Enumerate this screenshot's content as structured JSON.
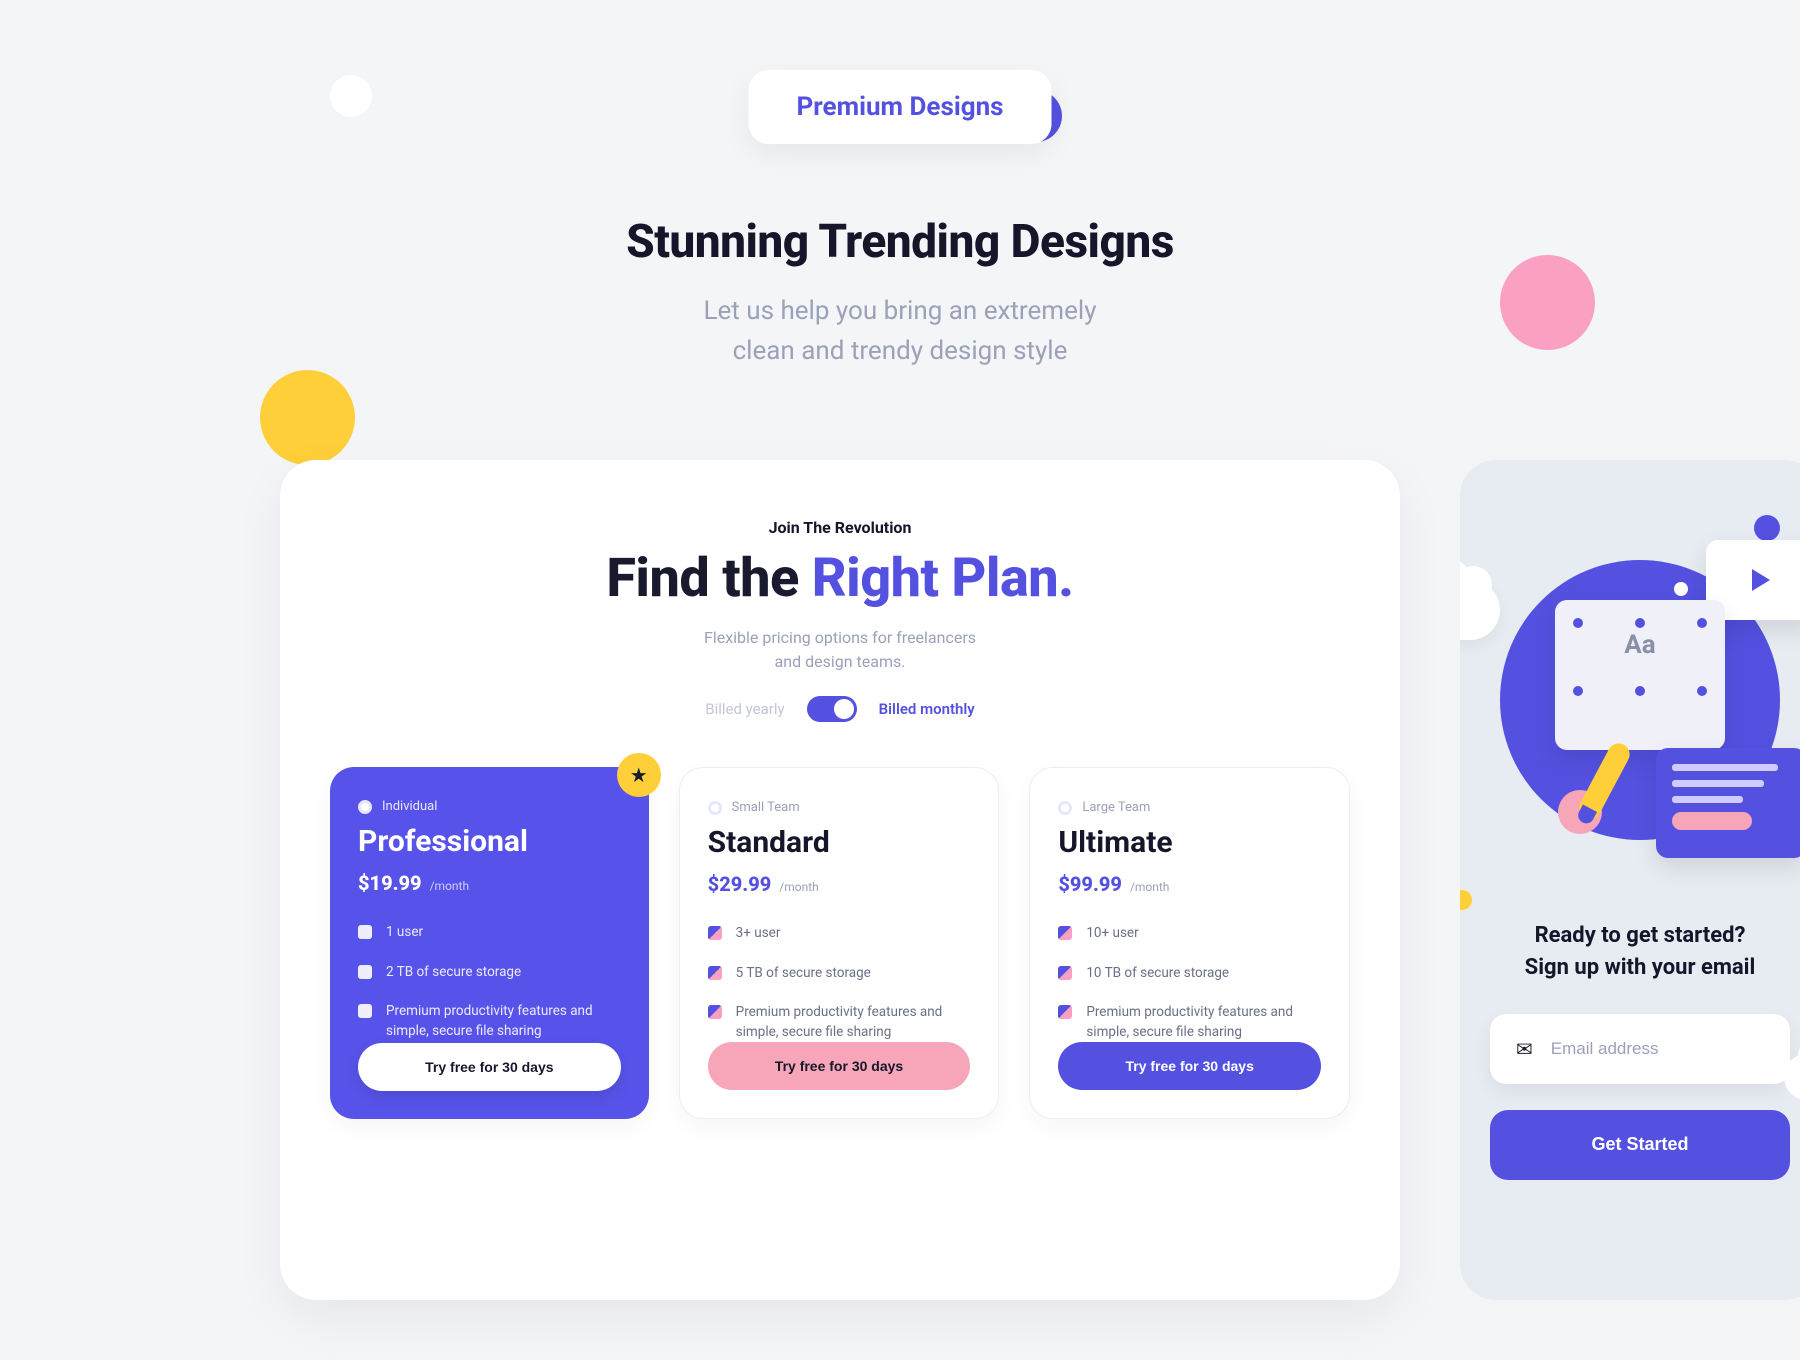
{
  "badge": "Premium Designs",
  "hero": {
    "title": "Stunning Trending Designs",
    "subtitle_l1": "Let us help you bring an extremely",
    "subtitle_l2": "clean and trendy design style"
  },
  "pricing": {
    "eyebrow": "Join The Revolution",
    "title_part1": "Find the ",
    "title_accent": "Right Plan.",
    "subtitle_l1": "Flexible pricing options for freelancers",
    "subtitle_l2": "and design teams.",
    "billing_yearly": "Billed yearly",
    "billing_monthly": "Billed monthly",
    "billing_selected": "monthly",
    "plans": [
      {
        "tag": "Individual",
        "name": "Professional",
        "price": "$19.99",
        "period": "/month",
        "featured": true,
        "cta": "Try free for 30 days",
        "features": [
          "1 user",
          "2 TB of secure storage",
          "Premium productivity features and simple, secure file sharing"
        ]
      },
      {
        "tag": "Small Team",
        "name": "Standard",
        "price": "$29.99",
        "period": "/month",
        "featured": false,
        "cta": "Try free for 30 days",
        "features": [
          "3+ user",
          "5 TB of secure storage",
          "Premium productivity features and simple, secure file sharing"
        ]
      },
      {
        "tag": "Large Team",
        "name": "Ultimate",
        "price": "$99.99",
        "period": "/month",
        "featured": false,
        "cta": "Try free for 30 days",
        "features": [
          "10+ user",
          "10 TB of secure storage",
          "Premium productivity features and simple, secure file sharing"
        ]
      }
    ]
  },
  "signup": {
    "heading_l1": "Ready to get started?",
    "heading_l2": "Sign up with your email",
    "email_placeholder": "Email address",
    "cta": "Get Started"
  },
  "colors": {
    "purple": "#5451e1",
    "pink": "#f6a6b8",
    "yellow": "#ffcf3a"
  }
}
